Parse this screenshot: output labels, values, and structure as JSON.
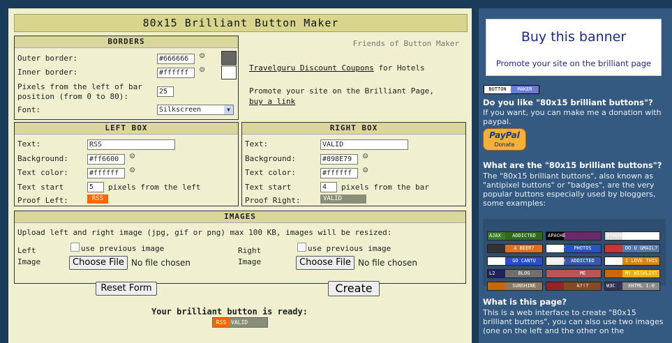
{
  "title": "80x15 Brilliant Button Maker",
  "borders": {
    "heading": "BORDERS",
    "outer_label": "Outer border:",
    "outer_value": "#666666",
    "outer_color": "#666666",
    "inner_label": "Inner border:",
    "inner_value": "#ffffff",
    "inner_color": "#ffffff",
    "pixels_label_1": "Pixels from the left of bar",
    "pixels_label_2": "position (from 0 to 80):",
    "pixels_value": "25",
    "font_label": "Font:",
    "font_value": "Silkscreen"
  },
  "friends": {
    "heading": "Friends of Button Maker",
    "link1": "Travelguru Discount Coupons",
    "link1_suffix": "for Hotels",
    "promote": "Promote your site on the Brilliant Page,",
    "buy_link": "buy a link"
  },
  "left_box": {
    "heading": "LEFT BOX",
    "text_label": "Text:",
    "text_value": "RSS",
    "bg_label": "Background:",
    "bg_value": "#ff6600",
    "color_label": "Text color:",
    "color_value": "#ffffff",
    "start_label": "Text start",
    "start_value": "5",
    "start_suffix": "pixels from the left",
    "proof_label": "Proof Left:",
    "proof_text": "RSS",
    "proof_color": "#ff6600"
  },
  "right_box": {
    "heading": "RIGHT BOX",
    "text_label": "Text:",
    "text_value": "VALID",
    "bg_label": "Background:",
    "bg_value": "#898E79",
    "color_label": "Text color:",
    "color_value": "#ffffff",
    "start_label": "Text start",
    "start_value": "4",
    "start_suffix": "pixels from the bar",
    "proof_label": "Proof Right:",
    "proof_text": "VALID",
    "proof_color": "#898E79"
  },
  "images": {
    "heading": "IMAGES",
    "upload_text": "Upload left and right image (jpg, gif or png) max 100 KB, images will be resized:",
    "left_label_1": "Left",
    "left_label_2": "Image",
    "right_label_1": "Right",
    "right_label_2": "Image",
    "use_previous": "use previous image",
    "choose_file": "Choose File",
    "no_file": "No file chosen"
  },
  "actions": {
    "reset": "Reset Form",
    "create": "Create",
    "ready": "Your brilliant button is ready:",
    "result_left": "RSS",
    "result_right": "VALID"
  },
  "sidebar": {
    "banner_title": "Buy this banner",
    "banner_sub": "Promote your site on the brilliant page",
    "logo_left": "BUTTON",
    "logo_right": "MAKER",
    "q1": "Do you like \"80x15 brilliant buttons\"?",
    "q1_text": "If you want, you can make me a donation with paypal.",
    "paypal_top": "PayPal",
    "paypal_bottom": "Donate",
    "q2": "What are the \"80x15 brilliant buttons\"?",
    "q2_text": "The \"80x15 brilliant buttons\", also known as \"antipixel buttons\" or \"badges\", are the very popular buttons especially used by bloggers, some examples:",
    "examples": [
      [
        "AJAX",
        "ADDICTED",
        "APACHE",
        "",
        "ATHENS '04",
        ""
      ],
      [
        "",
        "A BEER?",
        "flickr",
        "PHOTOS",
        "",
        "DO U GMAIL?"
      ],
      [
        "",
        "GO CANTU",
        "Google",
        "ADDICTED",
        "",
        "I LOVE THIS"
      ],
      [
        "L2",
        "BLOG",
        "",
        "ME",
        "",
        "MY WISHLIST"
      ],
      [
        "",
        "SUNSHINE",
        "",
        "k?!?",
        "W3C",
        "XHTML 1.0"
      ]
    ],
    "q3": "What is this page?",
    "q3_text": "This is a web interface to create \"80x15 brilliant buttons\", you can also use two images (one on the left and the other on the"
  }
}
